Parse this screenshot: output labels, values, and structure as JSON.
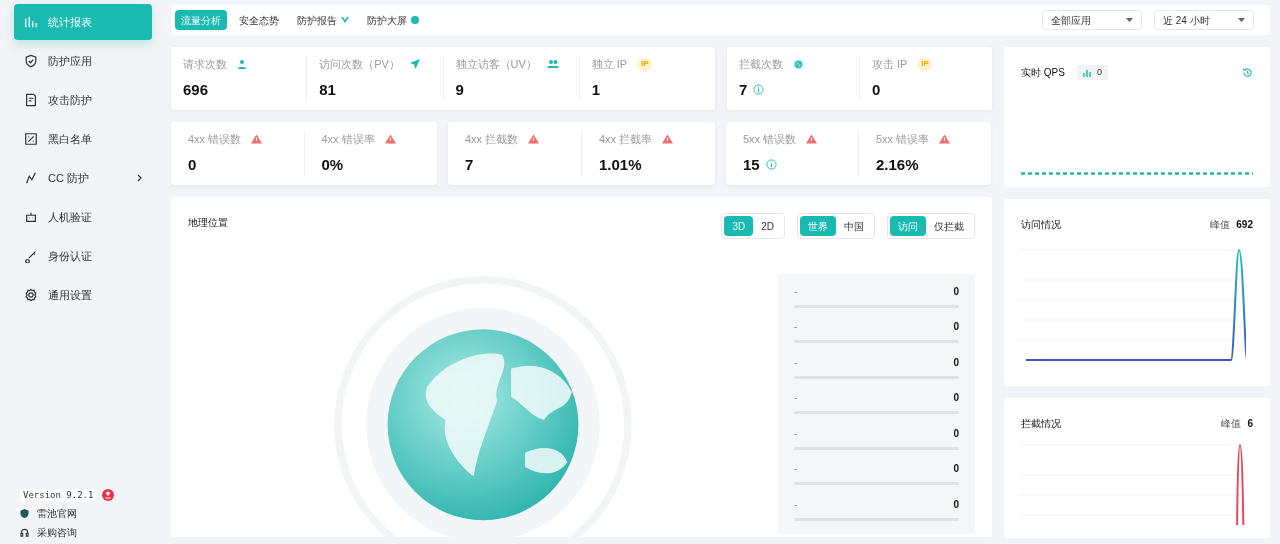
{
  "sidebar": {
    "items": [
      {
        "label": "统计报表",
        "selected": true,
        "has_submenu": false
      },
      {
        "label": "防护应用",
        "selected": false,
        "has_submenu": false
      },
      {
        "label": "攻击防护",
        "selected": false,
        "has_submenu": false
      },
      {
        "label": "黑白名单",
        "selected": false,
        "has_submenu": false
      },
      {
        "label": "CC 防护",
        "selected": false,
        "has_submenu": true
      },
      {
        "label": "人机验证",
        "selected": false,
        "has_submenu": false
      },
      {
        "label": "身份认证",
        "selected": false,
        "has_submenu": false
      },
      {
        "label": "通用设置",
        "selected": false,
        "has_submenu": false
      }
    ],
    "version": "Version 9.2.1",
    "links": [
      "雷池官网",
      "采购咨询"
    ]
  },
  "top_tabs": [
    {
      "label": "流量分析",
      "selected": true
    },
    {
      "label": "安全态势",
      "selected": false
    },
    {
      "label": "防护报告",
      "selected": false
    },
    {
      "label": "防护大屏",
      "selected": false
    }
  ],
  "filters": [
    {
      "value": "全部应用"
    },
    {
      "value": "近 24 小时"
    }
  ],
  "stat_groups": [
    [
      {
        "label": "请求次数",
        "value": "696",
        "info": false
      },
      {
        "label": "访问次数（PV）",
        "value": "81",
        "info": false
      },
      {
        "label": "独立访客（UV）",
        "value": "9",
        "info": false
      },
      {
        "label": "独立 IP",
        "value": "1",
        "info": false,
        "tag": "IP"
      }
    ],
    [
      {
        "label": "拦截次数",
        "value": "7",
        "info": true
      },
      {
        "label": "攻击 IP",
        "value": "0",
        "info": false,
        "tag": "IP"
      }
    ],
    [
      {
        "label": "4xx 错误数",
        "value": "0",
        "info": false
      },
      {
        "label": "4xx 错误率",
        "value": "0%",
        "info": false
      }
    ],
    [
      {
        "label": "4xx 拦截数",
        "value": "7",
        "info": false
      },
      {
        "label": "4xx 拦截率",
        "value": "1.01%",
        "info": false
      }
    ],
    [
      {
        "label": "5xx 错误数",
        "value": "15",
        "info": true
      },
      {
        "label": "5xx 错误率",
        "value": "2.16%",
        "info": false
      }
    ]
  ],
  "qps": {
    "title": "实时 QPS",
    "value": "0"
  },
  "geo": {
    "title": "地理位置",
    "toggles": [
      [
        {
          "label": "3D",
          "selected": true
        },
        {
          "label": "2D",
          "selected": false
        }
      ],
      [
        {
          "label": "世界",
          "selected": true
        },
        {
          "label": "中国",
          "selected": false
        }
      ],
      [
        {
          "label": "访问",
          "selected": true
        },
        {
          "label": "仅拦截",
          "selected": false
        }
      ]
    ],
    "ranking": [
      {
        "name": "-",
        "value": "0"
      },
      {
        "name": "-",
        "value": "0"
      },
      {
        "name": "-",
        "value": "0"
      },
      {
        "name": "-",
        "value": "0"
      },
      {
        "name": "-",
        "value": "0"
      },
      {
        "name": "-",
        "value": "0"
      },
      {
        "name": "-",
        "value": "0"
      }
    ]
  },
  "visits": {
    "title": "访问情况",
    "peak_label": "峰值",
    "peak_value": "692"
  },
  "blocks": {
    "title": "拦截情况",
    "peak_label": "峰值",
    "peak_value": "6"
  }
}
